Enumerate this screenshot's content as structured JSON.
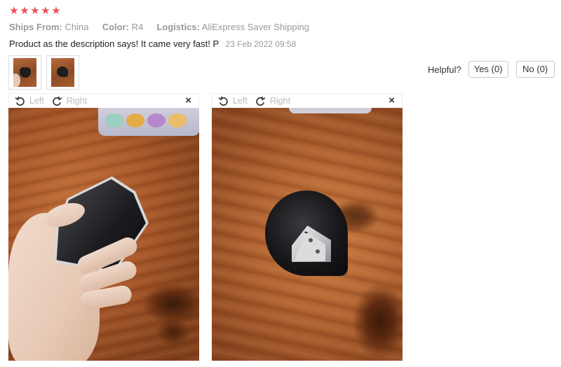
{
  "rating": {
    "stars": [
      "★",
      "★",
      "★",
      "★",
      "★"
    ],
    "value": 5,
    "max": 5,
    "color": "#f14e55"
  },
  "meta": {
    "ships_from_label": "Ships From:",
    "ships_from_value": "China",
    "color_label": "Color:",
    "color_value": "R4",
    "logistics_label": "Logistics:",
    "logistics_value": "AliExpress Saver Shipping"
  },
  "review": {
    "text": "Product as the description says! It came very fast! P",
    "date": "23 Feb 2022 09:58"
  },
  "thumbnails": [
    {
      "icon": "photo-thumbnail"
    },
    {
      "icon": "photo-thumbnail"
    }
  ],
  "helpful": {
    "label": "Helpful?",
    "yes_label": "Yes (0)",
    "no_label": "No (0)"
  },
  "viewers": [
    {
      "left_label": "Left",
      "right_label": "Right",
      "close_label": "×"
    },
    {
      "left_label": "Left",
      "right_label": "Right",
      "close_label": "×"
    }
  ]
}
